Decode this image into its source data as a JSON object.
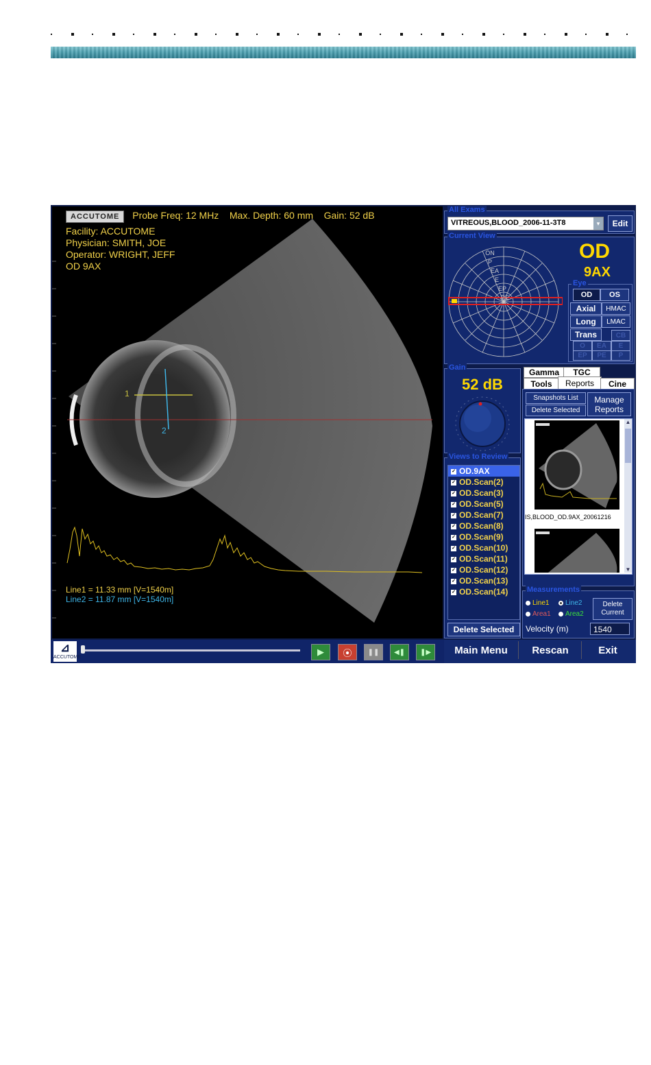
{
  "scan": {
    "logo": "ACCUTOME",
    "probe_freq": "Probe Freq: 12 MHz",
    "max_depth": "Max. Depth: 60 mm",
    "gain": "Gain: 52 dB",
    "facility": "Facility: ACCUTOME",
    "physician": "Physician: SMITH, JOE",
    "operator": "Operator: WRIGHT, JEFF",
    "eye_view": "OD  9AX",
    "marker1": "1",
    "marker2": "2",
    "line1": "Line1 = 11.33 mm     [V=1540m]",
    "line2": "Line2 = 11.87 mm     [V=1540m]"
  },
  "bottom_bar": {
    "logo_text": "ACCUTOME",
    "play": "▶",
    "record": "⦿",
    "pause": "❚❚",
    "step_back": "◀❚",
    "step_forward": "❚▶"
  },
  "all_exams": {
    "title": "All Exams",
    "selected": "VITREOUS,BLOOD_2006-11-3T8",
    "edit": "Edit"
  },
  "current_view": {
    "title": "Current View",
    "eye": "OD",
    "view": "9AX",
    "ring_labels": [
      "ON",
      "P",
      "EA",
      "E",
      "EP",
      "PE"
    ],
    "eye_panel_title": "Eye",
    "od": "OD",
    "os": "OS",
    "axial": "Axial",
    "hmac": "HMAC",
    "long": "Long",
    "lmac": "LMAC",
    "trans": "Trans",
    "cb": "CB",
    "o": "O",
    "ea": "EA",
    "e": "E",
    "ep": "EP",
    "pe": "PE",
    "p": "P"
  },
  "gain_panel": {
    "title": "Gain",
    "value": "52 dB"
  },
  "tabs": {
    "gamma": "Gamma",
    "tgc": "TGC",
    "tools": "Tools",
    "reports": "Reports",
    "cine": "Cine"
  },
  "reports": {
    "snapshots_list": "Snapshots List",
    "delete_selected": "Delete Selected",
    "manage_reports": "Manage Reports",
    "snapshot_caption": "IS,BLOOD_OD.9AX_20061216"
  },
  "views_to_review": {
    "title": "Views to Review",
    "items": [
      "OD.9AX",
      "OD.Scan(2)",
      "OD.Scan(3)",
      "OD.Scan(5)",
      "OD.Scan(7)",
      "OD.Scan(8)",
      "OD.Scan(9)",
      "OD.Scan(10)",
      "OD.Scan(11)",
      "OD.Scan(12)",
      "OD.Scan(13)",
      "OD.Scan(14)"
    ],
    "delete_selected": "Delete Selected"
  },
  "measurements": {
    "title": "Measurements",
    "line1": "Line1",
    "line2": "Line2",
    "area1": "Area1",
    "area2": "Area2",
    "delete_current": "Delete Current",
    "velocity_label": "Velocity (m)",
    "velocity_value": "1540"
  },
  "nav": {
    "main_menu": "Main Menu",
    "rescan": "Rescan",
    "exit": "Exit"
  },
  "colors": {
    "yellow": "#f2d24a",
    "cyan": "#3fb6e8",
    "panel": "#12286e",
    "selected": "#3a63e8"
  }
}
